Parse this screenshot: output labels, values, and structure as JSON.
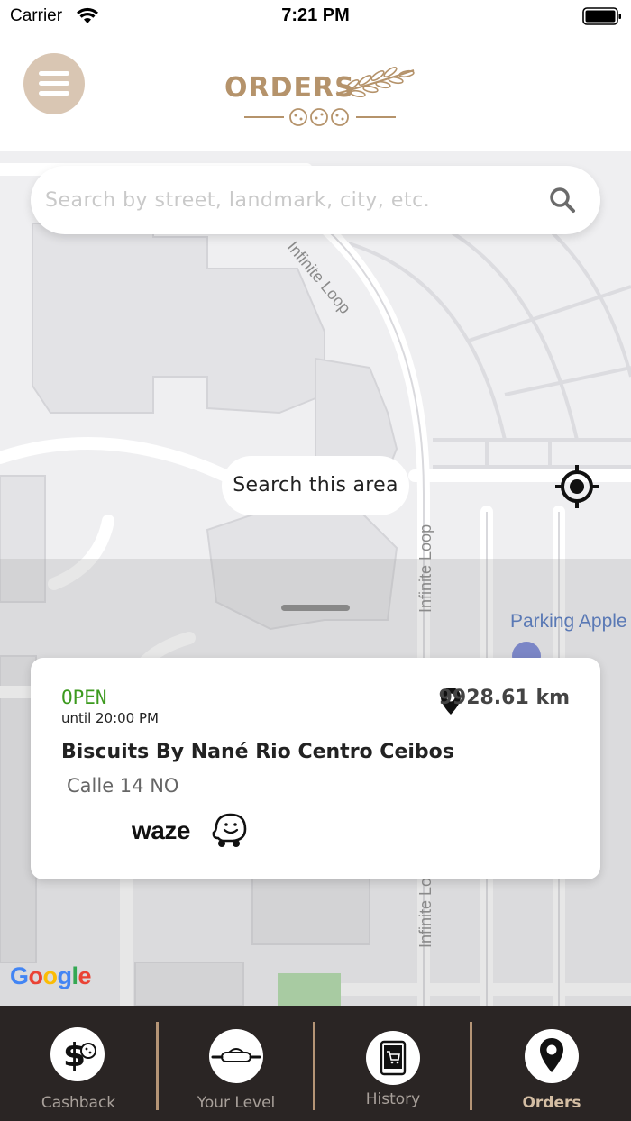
{
  "status_bar": {
    "carrier": "Carrier",
    "time": "7:21 PM",
    "icons": [
      "wifi-icon",
      "battery-icon"
    ]
  },
  "header": {
    "menu_icon": "hamburger-menu-icon",
    "logo_text": "ORDERS",
    "logo_decoration": [
      "wheat-branch-icon",
      "cookies-icon"
    ],
    "brand_color": "#b5936b",
    "menu_color": "#d9c6b3"
  },
  "map": {
    "search": {
      "placeholder": "Search by street, landmark, city, etc.",
      "value": "",
      "icon": "search-icon"
    },
    "search_area_button": "Search this area",
    "locate_icon": "crosshair-locate-icon",
    "street_labels": [
      "Infinite Loop",
      "Infinite Loop",
      "Infinite Loop"
    ],
    "poi_label": "Parking Apple",
    "attribution": "Google"
  },
  "store_card": {
    "status": "OPEN",
    "status_color": "#3c9a1e",
    "hours": "until 20:00 PM",
    "name": "Biscuits By Nané Rio Centro Ceibos",
    "address": "Calle 14 NO",
    "distance": "9928.61 km",
    "distance_icon": "map-pin-icon",
    "navigation_app": "waze"
  },
  "bottom_nav": {
    "background": "#2a2524",
    "items": [
      {
        "label": "Cashback",
        "icon": "dollar-cookie-icon",
        "active": false
      },
      {
        "label": "Your Level",
        "icon": "rolling-pin-icon",
        "active": false
      },
      {
        "label": "History",
        "icon": "tablet-cart-icon",
        "active": false
      },
      {
        "label": "Orders",
        "icon": "location-pin-icon",
        "active": true
      }
    ]
  }
}
